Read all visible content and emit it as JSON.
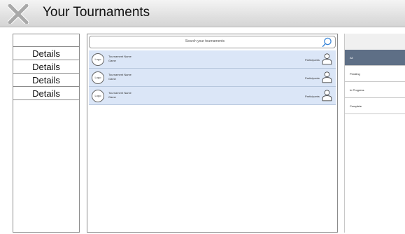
{
  "header": {
    "title": "Your Tournaments",
    "logo_icon": "x-mark-icon"
  },
  "sidebar": {
    "items": [
      {
        "label": "Details"
      },
      {
        "label": "Details"
      },
      {
        "label": "Details"
      },
      {
        "label": "Details"
      }
    ]
  },
  "search": {
    "placeholder": "Search your tournaments",
    "icon": "search-icon"
  },
  "tournaments": [
    {
      "logo": "Logo",
      "name": "Tournament Name",
      "game": "Game",
      "participants": "Participants"
    },
    {
      "logo": "Logo",
      "name": "Tournament Name",
      "game": "Game",
      "participants": "Participants"
    },
    {
      "logo": "Logo",
      "name": "Tournament Name",
      "game": "Game",
      "participants": "Participants"
    }
  ],
  "filters": [
    {
      "label": "All",
      "active": true
    },
    {
      "label": "Pending",
      "active": false
    },
    {
      "label": "In Progress",
      "active": false
    },
    {
      "label": "Complete",
      "active": false
    }
  ],
  "colors": {
    "row_highlight": "#dbe6f7",
    "filter_active": "#5e6f86",
    "header_gradient_top": "#f4f4f4",
    "header_gradient_bottom": "#d4d4d4"
  }
}
